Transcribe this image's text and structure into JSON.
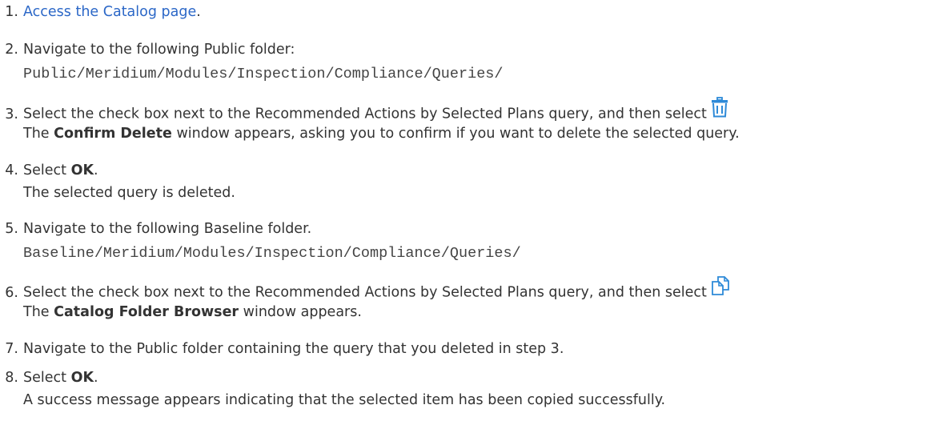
{
  "steps": [
    {
      "n": "1.",
      "link": "Access the Catalog page",
      "after": "."
    },
    {
      "n": "2.",
      "text": "Navigate to the following Public folder:",
      "path": "Public/Meridium/Modules/Inspection/Compliance/Queries/"
    },
    {
      "n": "3.",
      "text": "Select the check box next to the Recommended Actions by Selected Plans query, and then select",
      "icon": "delete-icon",
      "r_pre": "The",
      "r_bold": "Confirm Delete",
      "r_post": "window appears, asking you to confirm if you want to delete the selected query."
    },
    {
      "n": "4.",
      "pre": "Select",
      "bold": "OK",
      "after": ".",
      "result": "The selected query is deleted."
    },
    {
      "n": "5.",
      "text": "Navigate to the following Baseline folder.",
      "path": "Baseline/Meridium/Modules/Inspection/Compliance/Queries/"
    },
    {
      "n": "6.",
      "text": "Select the check box next to the Recommended Actions by Selected Plans query, and then select",
      "icon": "copy-icon",
      "r_pre": "The",
      "r_bold": "Catalog Folder Browser",
      "r_post": "window appears."
    },
    {
      "n": "7.",
      "text": "Navigate to the Public folder containing the query that you deleted in step 3."
    },
    {
      "n": "8.",
      "pre": "Select",
      "bold": "OK",
      "after": ".",
      "result": "A success message appears indicating that the selected item has been copied successfully."
    }
  ],
  "colors": {
    "text": "#333333",
    "link": "#2b67c7",
    "icon": "#2e8ad8"
  }
}
